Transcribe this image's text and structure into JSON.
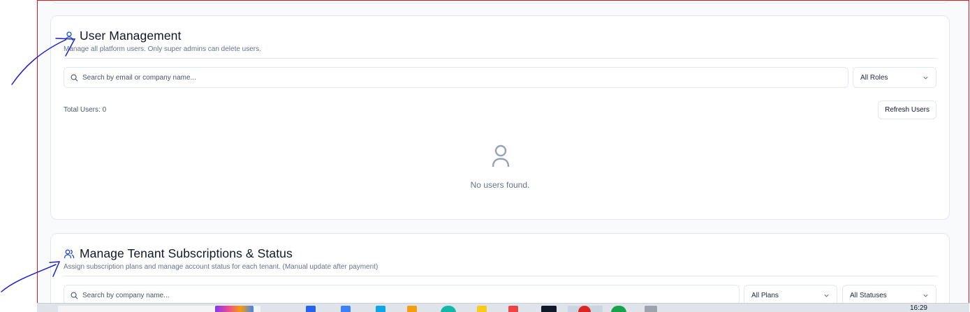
{
  "user_management": {
    "title": "User Management",
    "description": "Manage all platform users. Only super admins can delete users.",
    "search_placeholder": "Search by email or company name...",
    "role_filter": {
      "selected": "All Roles",
      "icon": "chevron-down-icon"
    },
    "total_users_label": "Total Users: 0",
    "refresh_button": "Refresh Users",
    "empty_state": "No users found.",
    "title_icon": "user-icon",
    "empty_icon": "user-icon"
  },
  "tenant_subscriptions": {
    "title": "Manage Tenant Subscriptions & Status",
    "description": "Assign subscription plans and manage account status for each tenant. (Manual update after payment)",
    "search_placeholder": "Search by company name...",
    "plan_filter": {
      "selected": "All Plans",
      "icon": "chevron-down-icon"
    },
    "status_filter": {
      "selected": "All Statuses",
      "icon": "chevron-down-icon"
    },
    "title_icon": "users-icon"
  },
  "taskbar": {
    "clock": "16:29"
  },
  "colors": {
    "frame_border": "#d71920",
    "accent_blue": "#1d4ed8",
    "annotation_ink": "#1e22c7",
    "muted_text": "#64748b"
  }
}
